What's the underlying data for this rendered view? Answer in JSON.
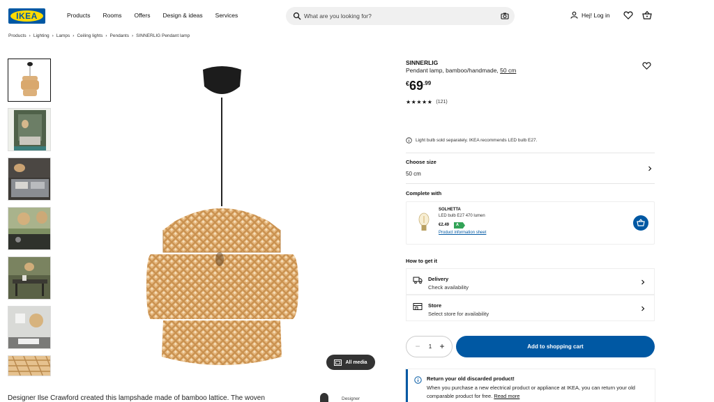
{
  "header": {
    "logo_text": "IKEA",
    "nav": [
      "Products",
      "Rooms",
      "Offers",
      "Design & ideas",
      "Services"
    ],
    "search_placeholder": "What are you looking for?",
    "login_label": "Hej! Log in"
  },
  "breadcrumb": [
    "Products",
    "Lighting",
    "Lamps",
    "Ceiling lights",
    "Pendants",
    "SINNERLIG Pendant lamp"
  ],
  "gallery": {
    "all_media_label": "All media"
  },
  "description": {
    "text": "Designer Ilse Crawford created this lampshade made of bamboo lattice. The woven",
    "designer_label": "Designer"
  },
  "product": {
    "name": "SINNERLIG",
    "desc_prefix": "Pendant lamp, bamboo/handmade,",
    "desc_size": "50 cm",
    "price_currency": "€",
    "price_int": "69",
    "price_dec": ".99",
    "rating": 5,
    "review_count": "(121)",
    "notice": "Light bulb sold separately. IKEA recommends LED bulb E27."
  },
  "size": {
    "label": "Choose size",
    "value": "50 cm"
  },
  "complete_with": {
    "label": "Complete with",
    "item_name": "SOLHETTA",
    "item_desc": "LED bulb E27 470 lumen",
    "item_price": "€2.49",
    "energy_class": "A",
    "info_link": "Product information sheet"
  },
  "how_to_get": {
    "label": "How to get it",
    "options": [
      {
        "title": "Delivery",
        "subtitle": "Check availability"
      },
      {
        "title": "Store",
        "subtitle": "Select store for availability"
      }
    ]
  },
  "purchase": {
    "quantity": "1",
    "add_to_cart": "Add to shopping cart"
  },
  "recycle": {
    "title": "Return your old discarded product!",
    "body": "When you purchase a new electrical product or appliance at IKEA, you can return your old comparable product for free.",
    "link": "Read more"
  },
  "colors": {
    "brand_blue": "#0058a3",
    "brand_yellow": "#ffdb00",
    "energy_green": "#33a357"
  }
}
